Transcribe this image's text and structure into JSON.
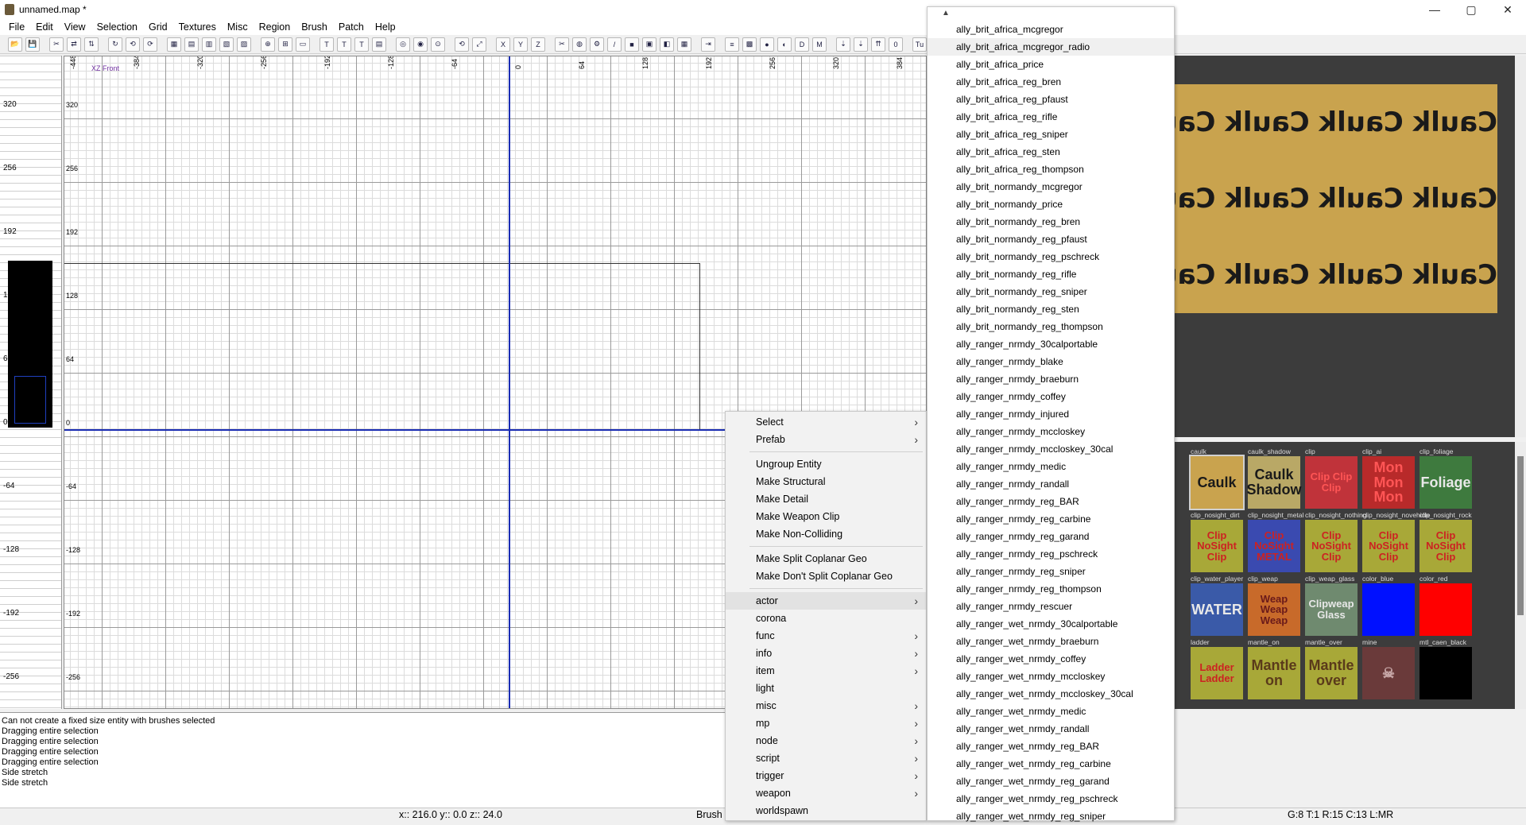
{
  "window": {
    "title": "unnamed.map *",
    "buttons": [
      "—",
      "▢",
      "✕"
    ]
  },
  "menubar": [
    "File",
    "Edit",
    "View",
    "Selection",
    "Grid",
    "Textures",
    "Misc",
    "Region",
    "Brush",
    "Patch",
    "Help"
  ],
  "xzview": {
    "name": "XZ Front",
    "x_ticks": [
      "-448",
      "-384",
      "-320",
      "-256",
      "-192",
      "-128",
      "-64",
      "0",
      "64",
      "128",
      "192",
      "256",
      "320",
      "384"
    ],
    "z_ticks": [
      "320",
      "256",
      "192",
      "128",
      "64",
      "0",
      "-64",
      "-128",
      "-192",
      "-256"
    ]
  },
  "zview": {
    "ticks": [
      "320",
      "256",
      "192",
      "1",
      "6",
      "0",
      "-64",
      "-128",
      "-192",
      "-256"
    ]
  },
  "console": {
    "lines": [
      "Can not create a fixed size entity with brushes selected",
      "Dragging entire selection",
      "Dragging entire selection",
      "Dragging entire selection",
      "Dragging entire selection",
      "Side stretch",
      "Side stretch"
    ]
  },
  "status": {
    "coords": "x:: 216.0  y:: 0.0  z:: 24.0",
    "brush": "Brush",
    "grid": "G:8 T:1 R:15 C:13 L:MR"
  },
  "texture_preview": {
    "row_text": "Caulk Caulk Caulk Caulk"
  },
  "texture_browser": {
    "tiles": [
      {
        "name": "caulk",
        "label": "Caulk",
        "bg": "#c9a34e",
        "fg": "#1a1a1a"
      },
      {
        "name": "caulk_shadow",
        "label": "Caulk Shadow",
        "bg": "#b9a866",
        "fg": "#1a1a1a"
      },
      {
        "name": "clip",
        "label": "Clip Clip Clip",
        "bg": "#c0333a",
        "fg": "#ff5555"
      },
      {
        "name": "clip_ai",
        "label": "Mon Mon Mon",
        "bg": "#b82a2a",
        "fg": "#ff5555"
      },
      {
        "name": "clip_foliage",
        "label": "Foliage",
        "bg": "#3e7a3e",
        "fg": "#e8e8e8"
      },
      {
        "name": "clip_nosight_dirt",
        "label": "Clip NoSight Clip",
        "bg": "#a8a838",
        "fg": "#cc2222"
      },
      {
        "name": "clip_nosight_metal",
        "label": "Clip NoSight METAL",
        "bg": "#3a4ab0",
        "fg": "#cc2222"
      },
      {
        "name": "clip_nosight_nothing",
        "label": "Clip NoSight Clip",
        "bg": "#a8a838",
        "fg": "#cc2222"
      },
      {
        "name": "clip_nosight_novehicle",
        "label": "Clip NoSight Clip",
        "bg": "#a8a838",
        "fg": "#cc2222"
      },
      {
        "name": "clip_nosight_rock",
        "label": "Clip NoSight Clip",
        "bg": "#a8a838",
        "fg": "#cc2222"
      },
      {
        "name": "clip_water_player",
        "label": "WATER",
        "bg": "#3a5aa8",
        "fg": "#e8e8e8"
      },
      {
        "name": "clip_weap",
        "label": "Weap Weap Weap",
        "bg": "#c86a2a",
        "fg": "#6a1a1a"
      },
      {
        "name": "clip_weap_glass",
        "label": "Clipweap Glass",
        "bg": "#6f8a6f",
        "fg": "#e8e8e8"
      },
      {
        "name": "color_blue",
        "label": "",
        "bg": "#0010ff",
        "fg": "#fff"
      },
      {
        "name": "color_red",
        "label": "",
        "bg": "#ff0000",
        "fg": "#fff"
      },
      {
        "name": "ladder",
        "label": "Ladder Ladder",
        "bg": "#a8a838",
        "fg": "#cc2222"
      },
      {
        "name": "mantle_on",
        "label": "Mantle on",
        "bg": "#a8a838",
        "fg": "#5a3a1a"
      },
      {
        "name": "mantle_over",
        "label": "Mantle over",
        "bg": "#a8a838",
        "fg": "#5a3a1a"
      },
      {
        "name": "mine",
        "label": "☠",
        "bg": "#6a3a3a",
        "fg": "#c8a8a8"
      },
      {
        "name": "mtl_caen_black",
        "label": "",
        "bg": "#000000",
        "fg": "#fff"
      }
    ]
  },
  "context_menu": {
    "items": [
      {
        "label": "Select",
        "sub": true
      },
      {
        "label": "Prefab",
        "sub": true
      },
      {
        "sep": true
      },
      {
        "label": "Ungroup Entity",
        "sub": false
      },
      {
        "label": "Make Structural",
        "sub": false
      },
      {
        "label": "Make Detail",
        "sub": false
      },
      {
        "label": "Make Weapon Clip",
        "sub": false
      },
      {
        "label": "Make Non-Colliding",
        "sub": false
      },
      {
        "sep": true
      },
      {
        "label": "Make Split Coplanar Geo",
        "sub": false
      },
      {
        "label": "Make Don't Split Coplanar Geo",
        "sub": false
      },
      {
        "sep": true
      },
      {
        "label": "actor",
        "sub": true,
        "highlight": true
      },
      {
        "label": "corona",
        "sub": false
      },
      {
        "label": "func",
        "sub": true
      },
      {
        "label": "info",
        "sub": true
      },
      {
        "label": "item",
        "sub": true
      },
      {
        "label": "light",
        "sub": false
      },
      {
        "label": "misc",
        "sub": true
      },
      {
        "label": "mp",
        "sub": true
      },
      {
        "label": "node",
        "sub": true
      },
      {
        "label": "script",
        "sub": true
      },
      {
        "label": "trigger",
        "sub": true
      },
      {
        "label": "weapon",
        "sub": true
      },
      {
        "label": "worldspawn",
        "sub": false
      }
    ]
  },
  "actor_submenu": {
    "highlight_index": 1,
    "items": [
      "ally_brit_africa_mcgregor",
      "ally_brit_africa_mcgregor_radio",
      "ally_brit_africa_price",
      "ally_brit_africa_reg_bren",
      "ally_brit_africa_reg_pfaust",
      "ally_brit_africa_reg_rifle",
      "ally_brit_africa_reg_sniper",
      "ally_brit_africa_reg_sten",
      "ally_brit_africa_reg_thompson",
      "ally_brit_normandy_mcgregor",
      "ally_brit_normandy_price",
      "ally_brit_normandy_reg_bren",
      "ally_brit_normandy_reg_pfaust",
      "ally_brit_normandy_reg_pschreck",
      "ally_brit_normandy_reg_rifle",
      "ally_brit_normandy_reg_sniper",
      "ally_brit_normandy_reg_sten",
      "ally_brit_normandy_reg_thompson",
      "ally_ranger_nrmdy_30calportable",
      "ally_ranger_nrmdy_blake",
      "ally_ranger_nrmdy_braeburn",
      "ally_ranger_nrmdy_coffey",
      "ally_ranger_nrmdy_injured",
      "ally_ranger_nrmdy_mccloskey",
      "ally_ranger_nrmdy_mccloskey_30cal",
      "ally_ranger_nrmdy_medic",
      "ally_ranger_nrmdy_randall",
      "ally_ranger_nrmdy_reg_BAR",
      "ally_ranger_nrmdy_reg_carbine",
      "ally_ranger_nrmdy_reg_garand",
      "ally_ranger_nrmdy_reg_pschreck",
      "ally_ranger_nrmdy_reg_sniper",
      "ally_ranger_nrmdy_reg_thompson",
      "ally_ranger_nrmdy_rescuer",
      "ally_ranger_wet_nrmdy_30calportable",
      "ally_ranger_wet_nrmdy_braeburn",
      "ally_ranger_wet_nrmdy_coffey",
      "ally_ranger_wet_nrmdy_mccloskey",
      "ally_ranger_wet_nrmdy_mccloskey_30cal",
      "ally_ranger_wet_nrmdy_medic",
      "ally_ranger_wet_nrmdy_randall",
      "ally_ranger_wet_nrmdy_reg_BAR",
      "ally_ranger_wet_nrmdy_reg_carbine",
      "ally_ranger_wet_nrmdy_reg_garand",
      "ally_ranger_wet_nrmdy_reg_pschreck",
      "ally_ranger_wet_nrmdy_reg_sniper"
    ]
  }
}
